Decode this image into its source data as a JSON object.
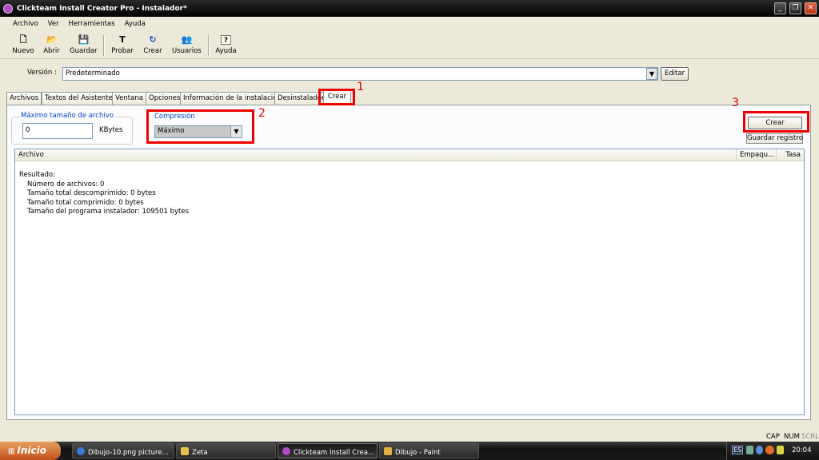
{
  "window": {
    "title": "Clickteam Install Creator Pro - Instalador*"
  },
  "menu": [
    "Archivo",
    "Ver",
    "Herramientas",
    "Ayuda"
  ],
  "toolbar": {
    "nuevo": "Nuevo",
    "abrir": "Abrir",
    "guardar": "Guardar",
    "probar": "Probar",
    "crear": "Crear",
    "usuarios": "Usuarios",
    "ayuda": "Ayuda"
  },
  "version": {
    "label": "Versión :",
    "value": "Predeterminado",
    "edit": "Editar"
  },
  "tabs": [
    "Archivos",
    "Textos del Asistente",
    "Ventana",
    "Opciones",
    "Información de la instalación",
    "Desinstalador",
    "Crear"
  ],
  "crear_tab": {
    "max_label": "Máximo tamaño de archivo",
    "max_value": "0",
    "kbytes": "KBytes",
    "comp_label": "Compresión",
    "comp_value": "Máximo",
    "crear_button": "Crear",
    "guardar_button": "Guardar registro",
    "columns": [
      "Archivo",
      "Empaqu...",
      "Tasa"
    ],
    "results_title": "Resultado:",
    "results": [
      "Número de archivos: 0",
      "Tamaño total descomprimido: 0 bytes",
      "Tamaño total comprimido: 0 bytes",
      "Tamaño del programa instalador: 109501 bytes"
    ]
  },
  "annotations": [
    "1",
    "2",
    "3"
  ],
  "annotation_color": "#ee0000",
  "status": {
    "cap": "CAP",
    "num": "NUM",
    "scrl": "SCRL"
  },
  "taskbar": {
    "start": "Inicio",
    "tasks": [
      "Dibujo-10.png picture...",
      "Zeta",
      "Clickteam Install Crea...",
      "Dibujo - Paint"
    ],
    "lang": "ES",
    "time": "20:04"
  }
}
